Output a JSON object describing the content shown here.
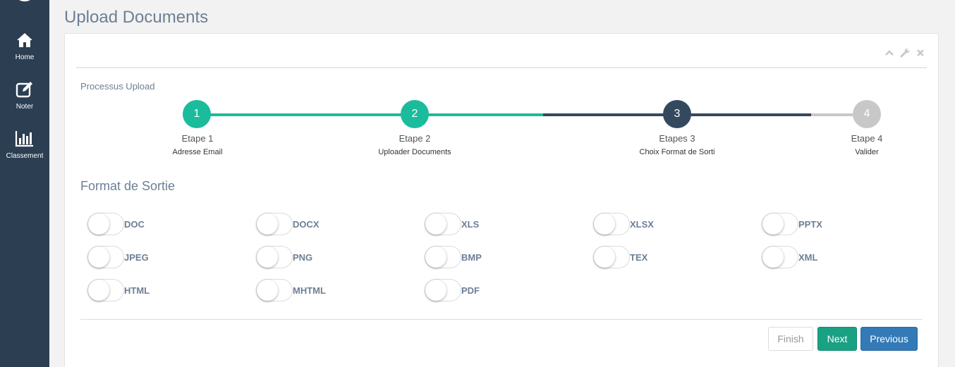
{
  "sidebar": {
    "items": [
      {
        "label": "Home",
        "icon": "home-icon"
      },
      {
        "label": "Noter",
        "icon": "edit-icon"
      },
      {
        "label": "Classement",
        "icon": "bar-chart-icon"
      }
    ]
  },
  "page": {
    "title": "Upload Documents"
  },
  "panel": {
    "tools": [
      "chevron-up-icon",
      "wrench-icon",
      "close-icon"
    ]
  },
  "wizard": {
    "title": "Processus Upload",
    "steps": [
      {
        "number": "1",
        "title": "Etape 1",
        "subtitle": "Adresse Email",
        "state": "done"
      },
      {
        "number": "2",
        "title": "Etape 2",
        "subtitle": "Uploader Documents",
        "state": "done"
      },
      {
        "number": "3",
        "title": "Etapes 3",
        "subtitle": "Choix Format de Sorti",
        "state": "current"
      },
      {
        "number": "4",
        "title": "Etape 4",
        "subtitle": "Valider",
        "state": "pending"
      }
    ]
  },
  "output": {
    "title": "Format de Sortie",
    "formats": [
      "DOC",
      "DOCX",
      "XLS",
      "XLSX",
      "PPTX",
      "JPEG",
      "PNG",
      "BMP",
      "TEX",
      "XML",
      "HTML",
      "MHTML",
      "PDF"
    ]
  },
  "buttons": {
    "finish": "Finish",
    "next": "Next",
    "previous": "Previous"
  },
  "colors": {
    "sidebar": "#2b3e52",
    "done": "#1abc9c",
    "current": "#34495e",
    "pending": "#c8c8c8",
    "next_button": "#1aa184",
    "previous_button": "#337ab7"
  }
}
